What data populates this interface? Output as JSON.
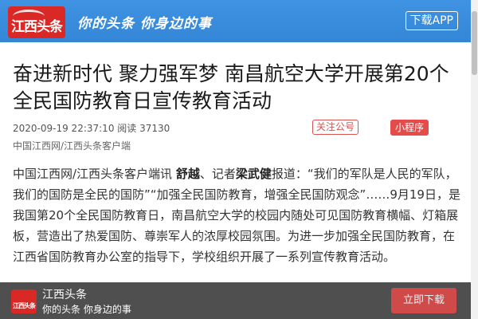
{
  "header": {
    "logo_text": "江西头条",
    "slogan": "你的头条 你身边的事",
    "download_label": "下载APP"
  },
  "article": {
    "title": "奋进新时代 聚力强军梦 南昌航空大学开展第20个全民国防教育日宣传教育活动",
    "meta": "2020-09-19 22:37:10 阅读 37130",
    "source": "中国江西网/江西头条客户端",
    "follow_label": "关注公号",
    "mini_program_label": "小程序",
    "body_prefix": "中国江西网/江西头条客户端讯 ",
    "author1": "舒越",
    "body_mid": "、记者",
    "author2": "梁武健",
    "body_rest": "报道：“我们的军队是人民的军队，我们的国防是全民的国防”“加强全民国防教育，增强全民国防观念”……9月19日，是我国第20个全民国防教育日，南昌航空大学的校园内随处可见国防教育横幅、灯箱展板，营造出了热爱国防、尊崇军人的浓厚校园氛围。为进一步加强全民国防教育，在江西省国防教育办公室的指导下，学校组织开展了一系列宣传教育活动。"
  },
  "banner": {
    "logo_text": "江西头条",
    "app_name": "江西头条",
    "slogan": "你的头条 你身边的事",
    "download_label": "立即下载"
  },
  "colors": {
    "header_blue": "#3b8fdd",
    "brand_red": "#d92826",
    "accent_red": "#e44c4c"
  }
}
